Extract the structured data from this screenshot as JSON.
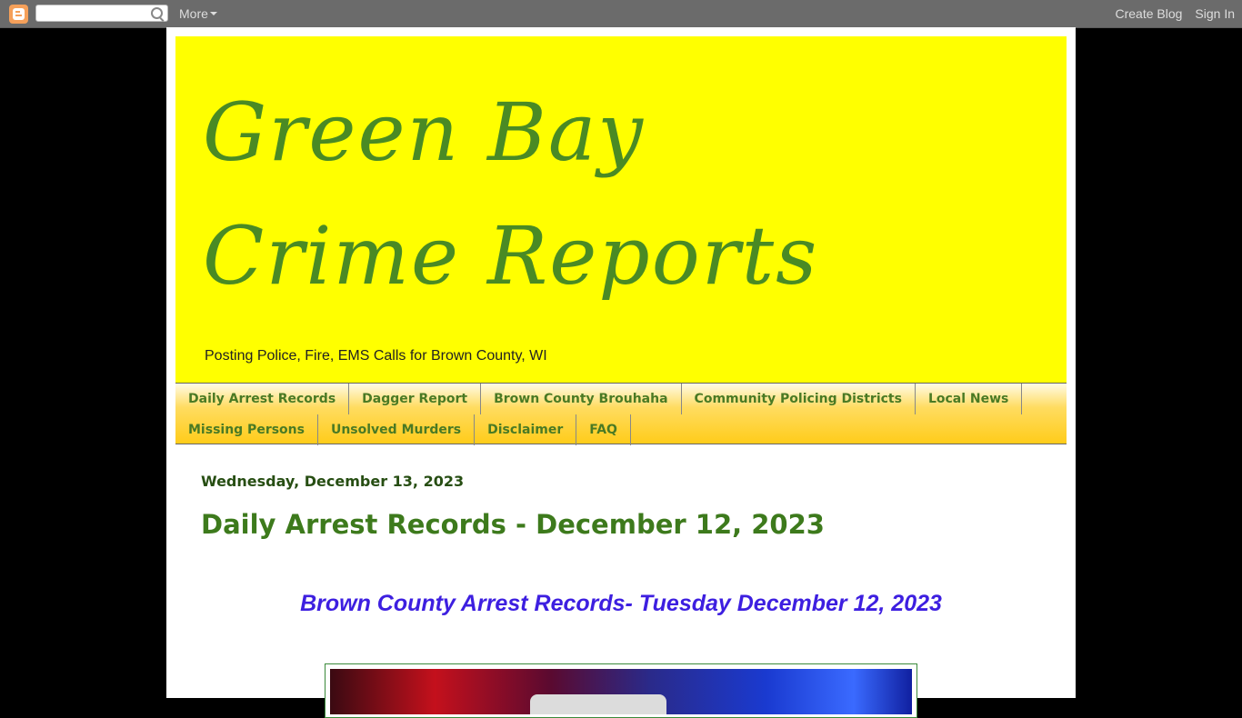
{
  "navbar": {
    "more_label": "More",
    "create_blog": "Create Blog",
    "sign_in": "Sign In",
    "search_value": ""
  },
  "header": {
    "title": "Green Bay Crime Reports",
    "description": "Posting Police, Fire, EMS Calls for Brown County, WI"
  },
  "tabs": {
    "row1": [
      "Daily Arrest Records",
      "Dagger Report",
      "Brown County Brouhaha",
      "Community Policing Districts",
      "Local News"
    ],
    "row2": [
      "Missing Persons",
      "Unsolved Murders",
      "Disclaimer",
      "FAQ"
    ]
  },
  "post": {
    "date": "Wednesday, December 13, 2023",
    "title": "Daily Arrest Records - December 12, 2023",
    "subtitle": "Brown County Arrest Records- Tuesday  December 12, 2023"
  },
  "colors": {
    "header_bg": "#ffff00",
    "title_green": "#4a8a24",
    "subtitle_blue": "#3d1fe0",
    "tab_gold": "#ffcc1a"
  }
}
